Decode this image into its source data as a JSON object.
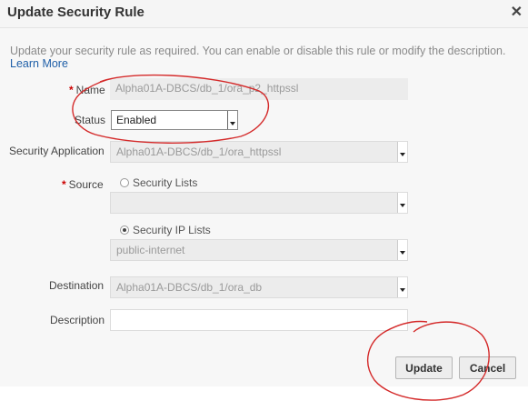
{
  "dialog": {
    "title": "Update Security Rule",
    "close_glyph": "✕",
    "description": "Update your security rule as required. You can enable or disable this rule or modify the description.",
    "learn_more": "Learn More"
  },
  "form": {
    "required_marker": "*",
    "name_label": "Name",
    "name_value": "Alpha01A-DBCS/db_1/ora_p2_httpssl",
    "status_label": "Status",
    "status_value": "Enabled",
    "security_application_label": "Security Application",
    "security_application_value": "Alpha01A-DBCS/db_1/ora_httpssl",
    "source_label": "Source",
    "source_option_lists": "Security Lists",
    "source_lists_value": "",
    "source_option_ip_lists": "Security IP Lists",
    "source_ip_lists_value": "public-internet",
    "destination_label": "Destination",
    "destination_value": "Alpha01A-DBCS/db_1/ora_db",
    "description_label": "Description",
    "description_value": ""
  },
  "buttons": {
    "update": "Update",
    "cancel": "Cancel"
  },
  "annotation_color": "#d42a2a"
}
